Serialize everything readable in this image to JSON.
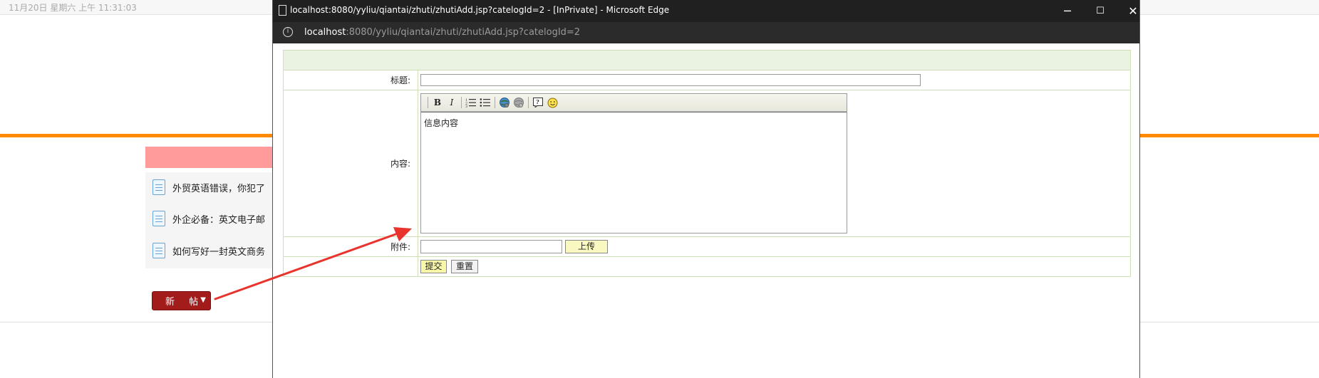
{
  "background_page": {
    "datetime": "11月20日 星期六 上午 11:31:03",
    "list_items": [
      "外贸英语错误，你犯了",
      "外企必备：英文电子邮",
      "如何写好一封英文商务"
    ],
    "new_post_label": "新 帖"
  },
  "window": {
    "title": "localhost:8080/yyliu/qiantai/zhuti/zhutiAdd.jsp?catelogId=2 - [InPrivate] - Microsoft Edge",
    "url_host": "localhost",
    "url_path": ":8080/yyliu/qiantai/zhuti/zhutiAdd.jsp?catelogId=2",
    "controls": {
      "minimize": "─",
      "maximize": "☐",
      "close": "✕"
    }
  },
  "form": {
    "title_label": "标题:",
    "title_value": "",
    "content_label": "内容:",
    "content_value": "信息内容",
    "attachment_label": "附件:",
    "upload_button": "上传",
    "submit_button": "提交",
    "reset_button": "重置"
  },
  "editor_toolbar": {
    "bold": "B",
    "italic": "I",
    "icons": [
      "bold-icon",
      "italic-icon",
      "ordered-list-icon",
      "unordered-list-icon",
      "link-icon",
      "unlink-icon",
      "help-icon",
      "smiley-icon"
    ]
  },
  "colors": {
    "accent_orange": "#ff8a00",
    "new_post_red": "#a31c1c",
    "annotation_red": "#e8342c",
    "form_border": "#cfe0b8"
  }
}
